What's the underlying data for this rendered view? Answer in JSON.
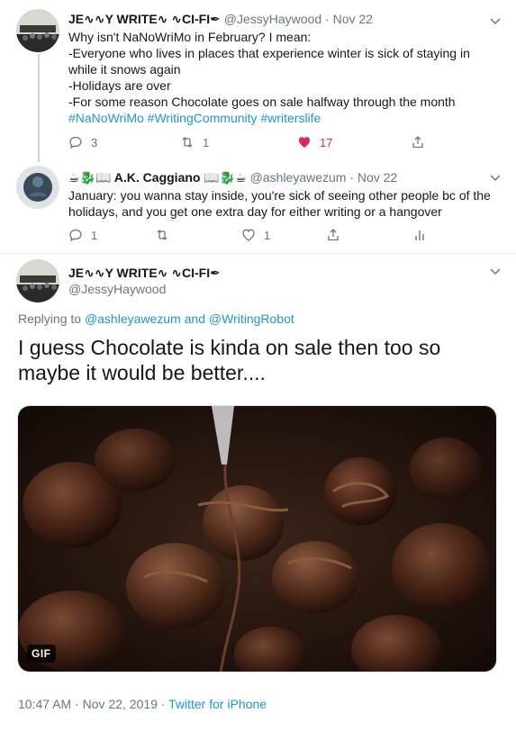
{
  "tweet1": {
    "name": "JE∿∿Y WRITE∿ ∿CI-FI✒",
    "handle": "@JessyHaywood",
    "dot": "·",
    "date": "Nov 22",
    "lines": [
      "Why isn't NaNoWriMo in February? I mean:",
      "-Everyone who lives in places that experience winter is sick of staying in",
      "while it snows again",
      "-Holidays are over",
      "-For some reason Chocolate goes on sale halfway through the month"
    ],
    "hashtags": [
      "#NaNoWriMo",
      "#WritingCommunity",
      "#writerslife"
    ],
    "reply_count": "3",
    "retweet_count": "1",
    "like_count": "17",
    "icons": [
      "reply-icon",
      "retweet-icon",
      "like-icon",
      "share-icon"
    ]
  },
  "tweet2": {
    "name": "☕🐉📖 A.K. Caggiano 📖🐉☕",
    "handle": "@ashleyawezum",
    "dot": "·",
    "date": "Nov 22",
    "lines": [
      "January: you wanna stay inside, you're sick of seeing other people bc of the",
      "holidays, and you get one extra day for either writing or a hangover"
    ],
    "reply_count": "1",
    "retweet_count": "",
    "like_count": "1",
    "icons": [
      "reply-icon",
      "retweet-icon",
      "like-icon",
      "share-icon",
      "analytics-icon"
    ]
  },
  "main": {
    "name": "JE∿∿Y WRITE∿ ∿CI-FI✒",
    "handle": "@JessyHaywood",
    "replying_prefix": "Replying to",
    "mention1": "@ashleyawezum",
    "and": "and",
    "mention2": "@WritingRobot",
    "text": "I guess Chocolate is kinda on sale then too so maybe it would be better....",
    "gif_label": "GIF",
    "time": "10:47 AM",
    "date": "Nov 22, 2019",
    "source": "Twitter for iPhone"
  },
  "colors": {
    "accent": "#1b95e0",
    "like": "#e0245e",
    "muted": "#657786"
  }
}
